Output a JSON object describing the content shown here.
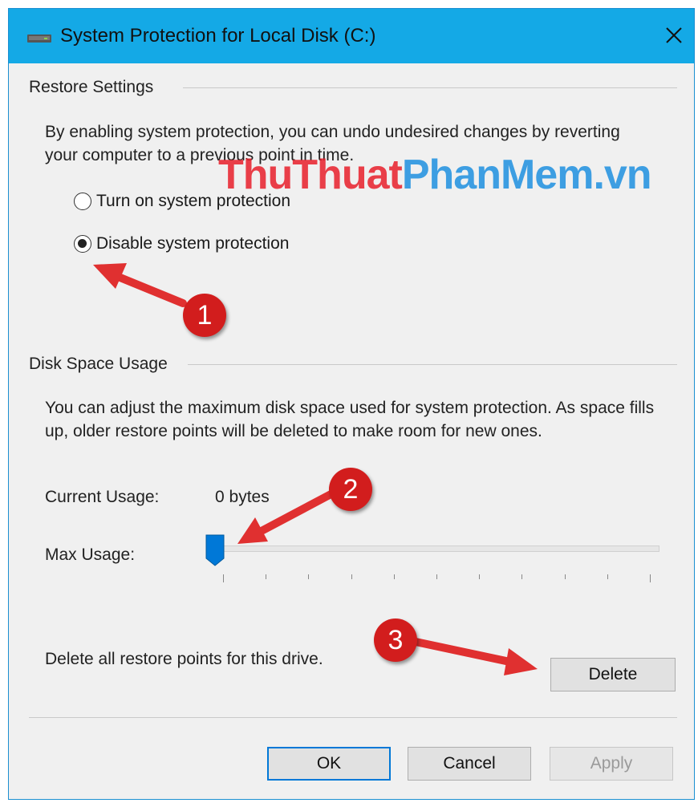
{
  "window": {
    "title": "System Protection for Local Disk (C:)",
    "icon": "drive-icon",
    "close_icon": "close-icon"
  },
  "restore_settings": {
    "heading": "Restore Settings",
    "description": "By enabling system protection, you can undo undesired changes by reverting your computer to a previous point in time.",
    "options": [
      {
        "label": "Turn on system protection",
        "checked": false
      },
      {
        "label": "Disable system protection",
        "checked": true
      }
    ]
  },
  "disk_space": {
    "heading": "Disk Space Usage",
    "description": "You can adjust the maximum disk space used for system protection. As space fills up, older restore points will be deleted to make room for new ones.",
    "current_usage_label": "Current Usage:",
    "current_usage_value": "0 bytes",
    "max_usage_label": "Max Usage:",
    "max_usage_fraction": 0,
    "delete_text": "Delete all restore points for this drive.",
    "delete_button": "Delete"
  },
  "footer": {
    "ok": "OK",
    "cancel": "Cancel",
    "apply": "Apply"
  },
  "watermark": {
    "part1": "ThuThuat",
    "part2": "PhanMem",
    "part3": ".vn"
  },
  "annotations": [
    "1",
    "2",
    "3"
  ],
  "colors": {
    "titlebar": "#14a9e6",
    "accent": "#0078d7",
    "annotation_red": "#d21d1d"
  }
}
